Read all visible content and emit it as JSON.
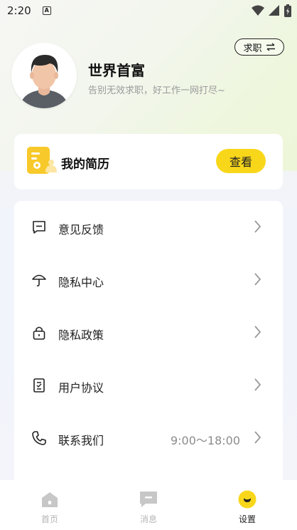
{
  "status_bar": {
    "time": "2:20",
    "badge": "A"
  },
  "header": {
    "job_toggle_label": "求职",
    "username": "世界首富",
    "tagline": "告别无效求职，好工作一网打尽~"
  },
  "resume_card": {
    "title": "我的简历",
    "button_label": "查看"
  },
  "menu": {
    "items": [
      {
        "label": "意见反馈",
        "value": "",
        "icon": "feedback-icon"
      },
      {
        "label": "隐私中心",
        "value": "",
        "icon": "umbrella-icon"
      },
      {
        "label": "隐私政策",
        "value": "",
        "icon": "lock-icon"
      },
      {
        "label": "用户协议",
        "value": "",
        "icon": "agreement-icon"
      },
      {
        "label": "联系我们",
        "value": "9:00～18:00",
        "icon": "phone-icon"
      }
    ]
  },
  "tab_bar": {
    "tabs": [
      {
        "label": "首页",
        "icon": "home-icon",
        "active": false
      },
      {
        "label": "消息",
        "icon": "message-icon",
        "active": false
      },
      {
        "label": "设置",
        "icon": "settings-icon",
        "active": true
      }
    ]
  },
  "colors": {
    "accent": "#f8d71a",
    "card": "#ffffff",
    "muted": "#9a9a9a"
  }
}
